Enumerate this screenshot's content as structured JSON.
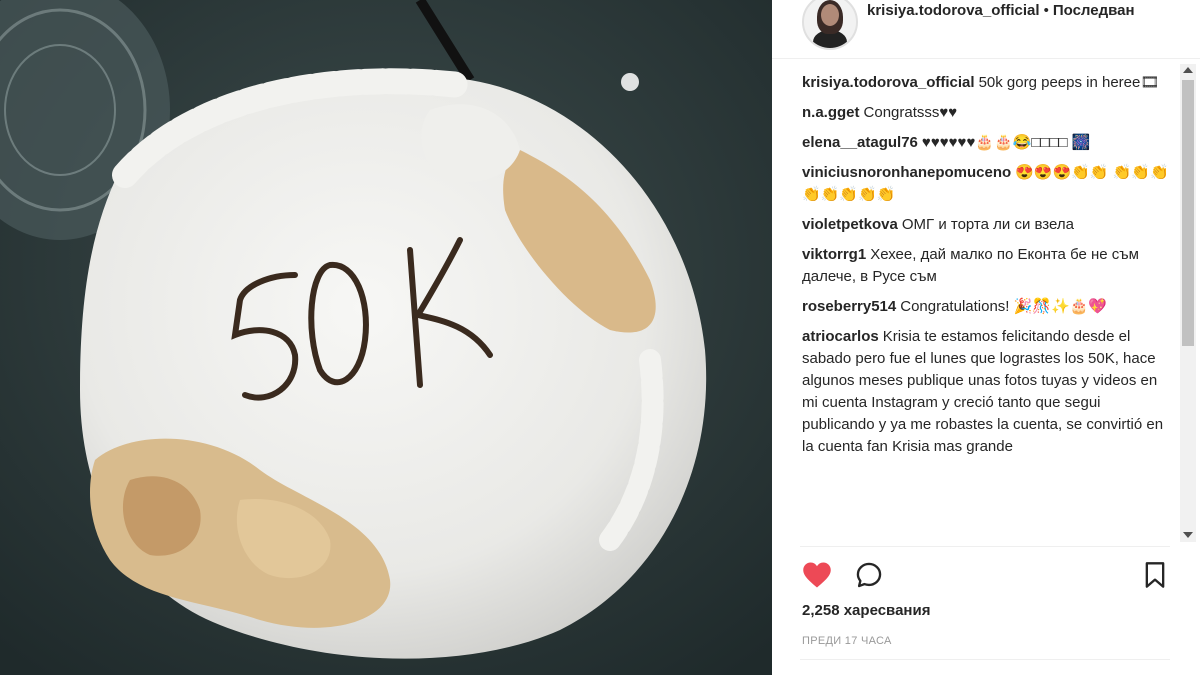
{
  "post": {
    "username": "krisiya.todorova_official",
    "separator": "•",
    "follow_status": "Последван"
  },
  "photo": {
    "cake_text": "50K",
    "description_icon": "cake-photo"
  },
  "comments": [
    {
      "user": "krisiya.todorova_official",
      "text": "50k gorg peeps in heree🎞"
    },
    {
      "user": "n.a.gget",
      "text": "Congratsss♥♥"
    },
    {
      "user": "elena__atagul76",
      "text": "♥♥♥♥♥♥🎂🎂😂□□□□ 🎆"
    },
    {
      "user": "viniciusnoronhanepomuceno",
      "text": "😍😍😍👏👏 👏👏👏👏👏👏👏👏"
    },
    {
      "user": "violetpetkova",
      "text": "ОМГ и торта ли си взела"
    },
    {
      "user": "viktorrg1",
      "text": "Хехее, дай малко по Еконта бе не съм далече, в Русе съм"
    },
    {
      "user": "roseberry514",
      "text": "Congratulations! 🎉🎊✨🎂💖"
    },
    {
      "user": "atriocarlos",
      "text": "Krisia te estamos felicitando desde el sabado pero fue el lunes que lograstes los 50K, hace algunos meses publique unas fotos tuyas y videos en mi cuenta Instagram y creció tanto que segui publicando y ya me robastes la cuenta, se convirtió en la cuenta fan Krisia mas grande"
    }
  ],
  "actions": {
    "like_icon": "heart-icon",
    "comment_icon": "comment-bubble-icon",
    "save_icon": "bookmark-icon",
    "like_color": "#ed4956"
  },
  "likes": {
    "count": "2,258",
    "label": "харесвания"
  },
  "timestamp": "ПРЕДИ 17 ЧАСА"
}
